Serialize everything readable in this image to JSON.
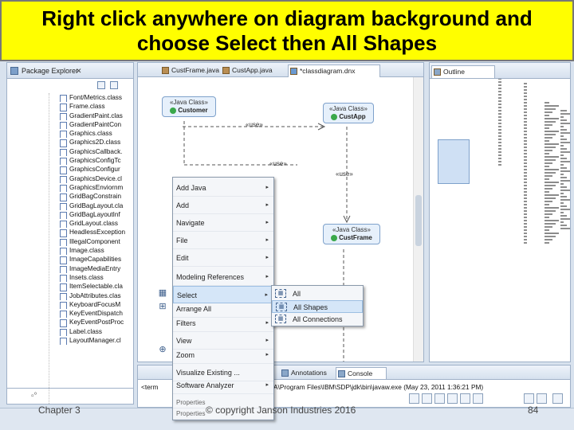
{
  "banner": {
    "line1": "Right click anywhere on diagram background and",
    "line2": "choose Select then All Shapes"
  },
  "package_explorer": {
    "title": "Package Explorer",
    "items": [
      "Font/Metrics.class",
      "Frame.class",
      "GradientPaint.clas",
      "GradientPaintCon",
      "Graphics.class",
      "Graphics2D.class",
      "GraphicsCallback.",
      "GraphicsConfigTc",
      "GraphicsConfigur",
      "GraphicsDevice.cl",
      "GraphicsEnviornm",
      "GridBagConstrain",
      "GridBagLayout.cla",
      "GridBagLayoutInf",
      "GridLayout.class",
      "HeadlessException",
      "IllegalComponent",
      "Image.class",
      "ImageCapabilities",
      "ImageMediaEntry",
      "Insets.class",
      "ItemSelectable.cla",
      "JobAttributes.clas",
      "KeyboardFocusM",
      "KeyEventDispatch",
      "KeyEventPostProc",
      "Label.class",
      "LayoutManager.cl"
    ]
  },
  "editor": {
    "tabs": [
      "CustFrame.java",
      "CustApp.java",
      "*classdiagram.dnx"
    ],
    "classes": [
      {
        "stereotype": "«Java Class»",
        "name": "Customer"
      },
      {
        "stereotype": "«Java Class»",
        "name": "CustApp"
      },
      {
        "stereotype": "«Java Class»",
        "name": "CustFrame"
      }
    ],
    "use_labels": [
      "«use»",
      "«use»",
      "«use»"
    ]
  },
  "outline": {
    "title": "Outline"
  },
  "bottom_panel": {
    "tabs": [
      "Annotations",
      "Console"
    ],
    "console_prefix": "<term",
    "console_text": "A\\Program Files\\IBM\\SDP\\jdk\\bin\\javaw.exe (May 23, 2011 1:36:21 PM)"
  },
  "context_menu": {
    "items": [
      {
        "label": "Add Java",
        "arrow": true
      },
      {
        "label": "Add",
        "arrow": true
      },
      {
        "label": "Navigate",
        "arrow": true
      },
      {
        "label": "File",
        "arrow": true
      },
      {
        "label": "Edit",
        "arrow": true
      },
      {
        "label": "Modeling References",
        "arrow": true
      },
      {
        "label": "Select",
        "arrow": true
      },
      {
        "label": "Arrange All",
        "arrow": false
      },
      {
        "label": "Filters",
        "arrow": true
      },
      {
        "label": "View",
        "arrow": true
      },
      {
        "label": "Zoom",
        "arrow": true
      },
      {
        "label": "Visualize Existing ...",
        "arrow": false
      },
      {
        "label": "Software Analyzer",
        "arrow": true
      },
      {
        "label": "Properties",
        "arrow": false
      },
      {
        "label": "Properties",
        "arrow": false
      }
    ],
    "arrow_glyph": "▸"
  },
  "submenu": {
    "items": [
      "All",
      "All Shapes",
      "All Connections"
    ]
  },
  "footer": {
    "chapter": "Chapter 3",
    "copyright": "© copyright Janson Industries 2016",
    "page": "84"
  },
  "colors": {
    "banner": "#fffe00",
    "highlight": "#d5e6f8"
  }
}
